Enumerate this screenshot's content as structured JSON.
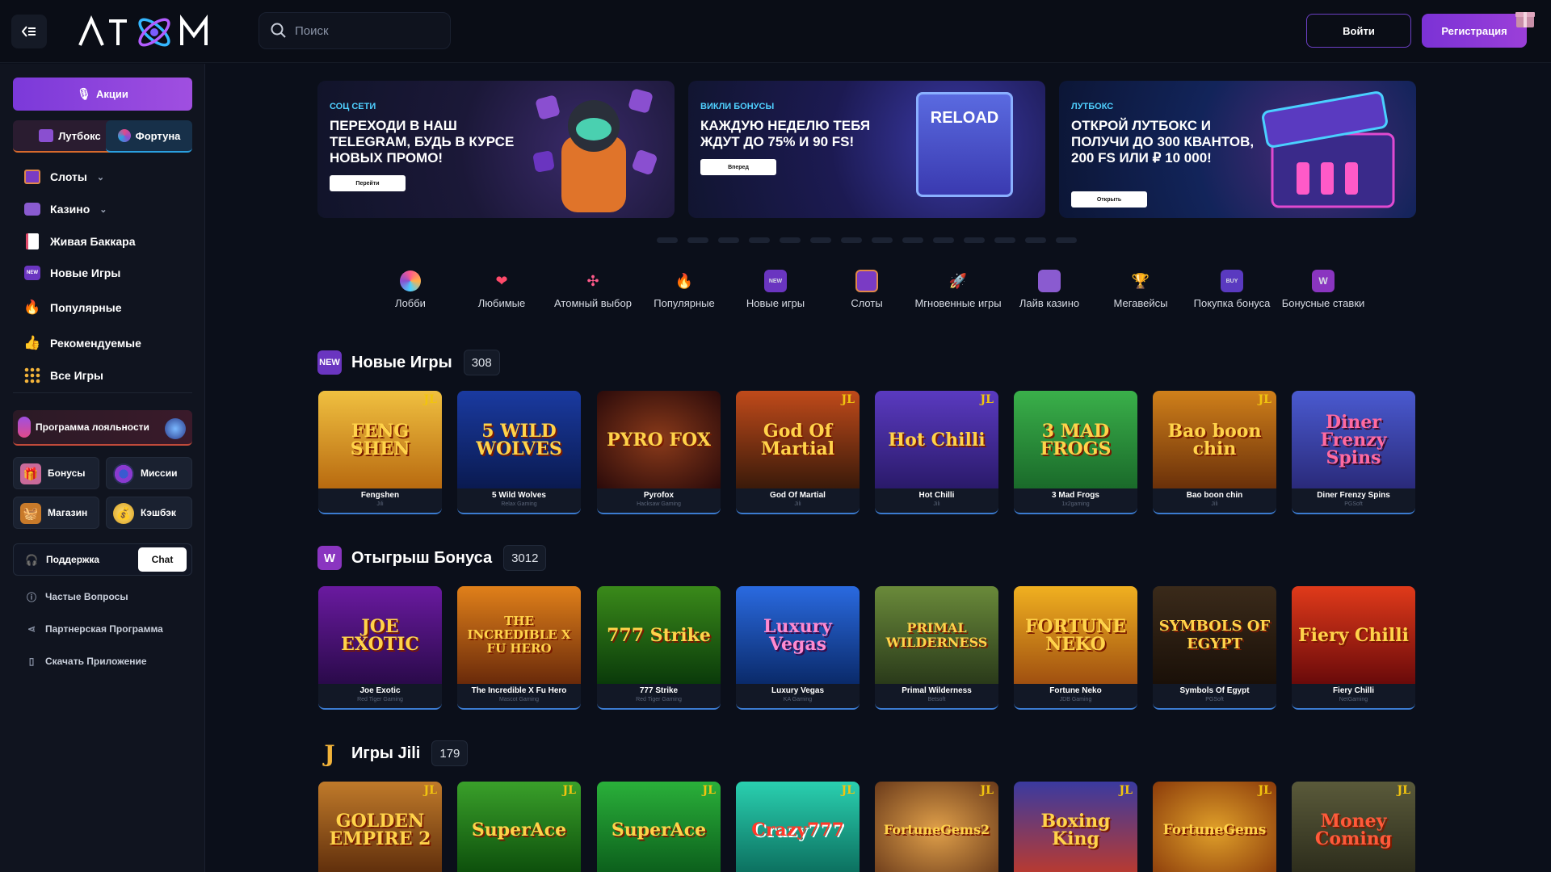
{
  "header": {
    "logo_text": "ATOM",
    "search_placeholder": "Поиск",
    "login_label": "Войти",
    "register_label": "Регистрация"
  },
  "sidebar": {
    "promo_label": "Акции",
    "lootbox_label": "Лутбокс",
    "fortune_label": "Фортуна",
    "nav": [
      {
        "label": "Слоты",
        "icon": "slots-icon",
        "expandable": true
      },
      {
        "label": "Казино",
        "icon": "casino-icon",
        "expandable": true
      },
      {
        "label": "Живая Баккара",
        "icon": "baccarat-icon",
        "expandable": false
      },
      {
        "label": "Новые Игры",
        "icon": "new-games-icon",
        "expandable": false
      },
      {
        "label": "Популярные",
        "icon": "fire-icon",
        "expandable": false
      },
      {
        "label": "Рекомендуемые",
        "icon": "thumbs-up-icon",
        "expandable": false
      },
      {
        "label": "Все Игры",
        "icon": "grid-icon",
        "expandable": false
      }
    ],
    "loyalty_label": "Программа лояльности",
    "grid": [
      {
        "label": "Бонусы",
        "icon": "gift-icon"
      },
      {
        "label": "Миссии",
        "icon": "target-icon"
      },
      {
        "label": "Магазин",
        "icon": "basket-icon"
      },
      {
        "label": "Кэшбэк",
        "icon": "coins-icon"
      }
    ],
    "support_label": "Поддержка",
    "chat_label": "Chat",
    "links": [
      {
        "label": "Частые Вопросы",
        "icon": "question-icon"
      },
      {
        "label": "Партнерская Программа",
        "icon": "share-icon"
      },
      {
        "label": "Скачать Приложение",
        "icon": "phone-icon"
      }
    ]
  },
  "banners": [
    {
      "tag": "СОЦ СЕТИ",
      "title": "Переходи в наш Telegram, будь в курсе новых промо!",
      "button": "Перейти"
    },
    {
      "tag": "ВИКЛИ БОНУСЫ",
      "title": "Каждую неделю тебя ждут до 75% и 90 FS!",
      "button": "Вперед",
      "art_text": "RELOAD"
    },
    {
      "tag": "ЛУТБОКС",
      "title": "Открой лутбокс и получи до 300 квантов, 200 FS или ₽ 10 000!",
      "button": "Открыть"
    }
  ],
  "carousel_dots": 14,
  "categories": [
    {
      "label": "Лобби",
      "icon": "lobby-icon"
    },
    {
      "label": "Любимые",
      "icon": "heart-icon"
    },
    {
      "label": "Атомный выбор",
      "icon": "atom-icon"
    },
    {
      "label": "Популярные",
      "icon": "fire-icon"
    },
    {
      "label": "Новые игры",
      "icon": "new-icon"
    },
    {
      "label": "Слоты",
      "icon": "slots-icon"
    },
    {
      "label": "Мгновенные игры",
      "icon": "rocket-icon"
    },
    {
      "label": "Лайв казино",
      "icon": "cards-icon"
    },
    {
      "label": "Мегавейсы",
      "icon": "trophy-icon"
    },
    {
      "label": "Покупка бонуса",
      "icon": "buy-icon"
    },
    {
      "label": "Бонусные ставки",
      "icon": "bonus-w-icon"
    }
  ],
  "sections": [
    {
      "title": "Новые Игры",
      "count": "308",
      "icon_text": "NEW",
      "games": [
        {
          "name": "Fengshen",
          "provider": "Jili",
          "art": "FENG SHEN",
          "jl": true
        },
        {
          "name": "5 Wild Wolves",
          "provider": "Relax Gaming",
          "art": "5 WILD WOLVES",
          "jl": false
        },
        {
          "name": "Pyrofox",
          "provider": "Hacksaw Gaming",
          "art": "PYRO FOX",
          "jl": false
        },
        {
          "name": "God Of Martial",
          "provider": "Jili",
          "art": "God Of Martial",
          "jl": true
        },
        {
          "name": "Hot Chilli",
          "provider": "Jili",
          "art": "Hot Chilli",
          "jl": true
        },
        {
          "name": "3 Mad Frogs",
          "provider": "1x2gaming",
          "art": "3 MAD FROGS",
          "jl": false
        },
        {
          "name": "Bao boon chin",
          "provider": "Jili",
          "art": "Bao boon chin",
          "jl": true
        },
        {
          "name": "Diner Frenzy Spins",
          "provider": "PGSoft",
          "art": "Diner Frenzy Spins",
          "jl": false
        }
      ]
    },
    {
      "title": "Отыгрыш Бонуса",
      "count": "3012",
      "icon_text": "W",
      "games": [
        {
          "name": "Joe Exotic",
          "provider": "Red Tiger Gaming",
          "art": "JOE EXOTIC",
          "jl": false
        },
        {
          "name": "The Incredible X Fu Hero",
          "provider": "Mascot Gaming",
          "art": "THE INCREDIBLE X FU HERO",
          "jl": false
        },
        {
          "name": "777 Strike",
          "provider": "Red Tiger Gaming",
          "art": "777 Strike",
          "jl": false
        },
        {
          "name": "Luxury Vegas",
          "provider": "KA Gaming",
          "art": "Luxury Vegas",
          "jl": false
        },
        {
          "name": "Primal Wilderness",
          "provider": "Betsoft",
          "art": "PRIMAL WILDERNESS",
          "jl": false
        },
        {
          "name": "Fortune Neko",
          "provider": "JDB Gaming",
          "art": "FORTUNE NEKO",
          "jl": false
        },
        {
          "name": "Symbols Of Egypt",
          "provider": "PGSoft",
          "art": "SYMBOLS OF EGYPT",
          "jl": false
        },
        {
          "name": "Fiery Chilli",
          "provider": "NetGaming",
          "art": "Fiery Chilli",
          "jl": false
        }
      ]
    },
    {
      "title": "Игры Jili",
      "count": "179",
      "icon_text": "J",
      "games": [
        {
          "name": "",
          "provider": "",
          "art": "GOLDEN EMPIRE 2",
          "jl": true
        },
        {
          "name": "",
          "provider": "",
          "art": "SuperAce",
          "jl": true
        },
        {
          "name": "",
          "provider": "",
          "art": "SuperAce",
          "jl": true
        },
        {
          "name": "",
          "provider": "",
          "art": "Crazy777",
          "jl": true
        },
        {
          "name": "",
          "provider": "",
          "art": "FortuneGems2",
          "jl": true
        },
        {
          "name": "",
          "provider": "",
          "art": "Boxing King",
          "jl": true
        },
        {
          "name": "",
          "provider": "",
          "art": "FortuneGems",
          "jl": true
        },
        {
          "name": "",
          "provider": "",
          "art": "Money Coming",
          "jl": true
        }
      ]
    }
  ],
  "colors": {
    "accent": "#8a3adb",
    "background": "#0b0f1a",
    "sidebar": "#10141f"
  }
}
